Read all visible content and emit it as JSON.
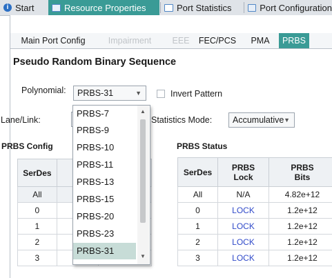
{
  "top_tabs": [
    {
      "label": "Start",
      "icon": "info-icon"
    },
    {
      "label": "Resource Properties",
      "icon": "properties-icon"
    },
    {
      "label": "Port Statistics",
      "icon": "statistics-icon"
    },
    {
      "label": "Port Configuration",
      "icon": "configuration-icon"
    }
  ],
  "sub_tabs": [
    "Main Port Config",
    "Impairment",
    "EEE",
    "FEC/PCS",
    "PMA",
    "PRBS"
  ],
  "page_title": "Pseudo Random Binary Sequence",
  "polynomial": {
    "label": "Polynomial:",
    "value": "PRBS-31"
  },
  "invert_pattern": {
    "label": "Invert Pattern",
    "checked": false
  },
  "lane_link_label": "Lane/Link:",
  "statistics_mode": {
    "label": "Statistics Mode:",
    "value": "Accumulative"
  },
  "prbs_config": {
    "title": "PRBS Config",
    "header": "SerDes",
    "rows": [
      {
        "serdes": "All"
      },
      {
        "serdes": "0"
      },
      {
        "serdes": "1"
      },
      {
        "serdes": "2"
      },
      {
        "serdes": "3",
        "checked": true
      }
    ]
  },
  "prbs_status": {
    "title": "PRBS Status",
    "headers": [
      "SerDes",
      "PRBS\nLock",
      "PRBS\nBits"
    ],
    "rows": [
      {
        "serdes": "All",
        "lock": "N/A",
        "bits": "4.82e+12"
      },
      {
        "serdes": "0",
        "lock": "LOCK",
        "bits": "1.2e+12"
      },
      {
        "serdes": "1",
        "lock": "LOCK",
        "bits": "1.2e+12"
      },
      {
        "serdes": "2",
        "lock": "LOCK",
        "bits": "1.2e+12"
      },
      {
        "serdes": "3",
        "lock": "LOCK",
        "bits": "1.2e+12"
      }
    ]
  },
  "polynomial_options": [
    "PRBS-7",
    "PRBS-9",
    "PRBS-10",
    "PRBS-11",
    "PRBS-13",
    "PRBS-15",
    "PRBS-20",
    "PRBS-23",
    "PRBS-31"
  ],
  "selected_option": "PRBS-31",
  "colors": {
    "accent": "#3a9b96",
    "lock_text": "#2f49c9",
    "selected_option_bg": "#c7dcd7"
  }
}
